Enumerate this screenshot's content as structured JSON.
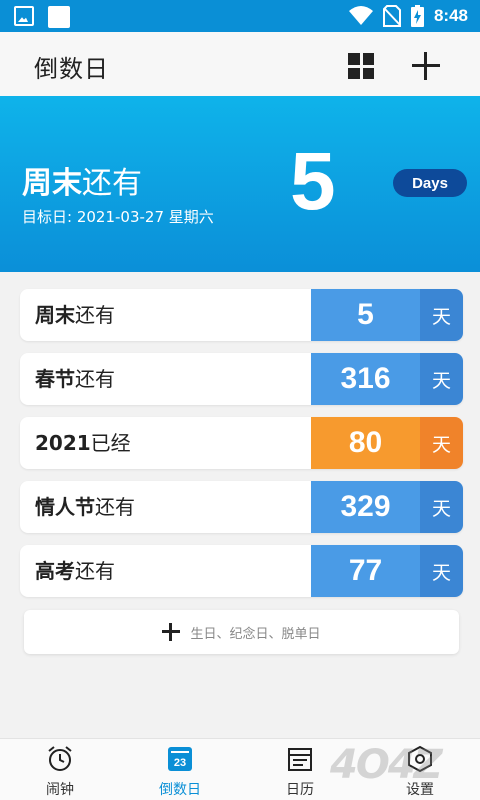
{
  "status_bar": {
    "time": "8:48"
  },
  "app_bar": {
    "title": "倒数日"
  },
  "hero": {
    "title_bold": "周末",
    "title_rest": "还有",
    "target_date": "目标日: 2021-03-27 星期六",
    "count": "5",
    "unit_badge": "Days"
  },
  "list": {
    "items": [
      {
        "name_bold": "周末",
        "name_rest": "还有",
        "count": "5",
        "unit": "天",
        "color": "#4a9be6",
        "unit_color": "#3b86d4"
      },
      {
        "name_bold": "春节",
        "name_rest": "还有",
        "count": "316",
        "unit": "天",
        "color": "#4a9be6",
        "unit_color": "#3b86d4"
      },
      {
        "name_bold": "2021",
        "name_rest": "已经",
        "count": "80",
        "unit": "天",
        "color": "#f79a2e",
        "unit_color": "#f0832a"
      },
      {
        "name_bold": "情人节",
        "name_rest": "还有",
        "count": "329",
        "unit": "天",
        "color": "#4a9be6",
        "unit_color": "#3b86d4"
      },
      {
        "name_bold": "高考",
        "name_rest": "还有",
        "count": "77",
        "unit": "天",
        "color": "#4a9be6",
        "unit_color": "#3b86d4"
      }
    ]
  },
  "add_card": {
    "hint": "生日、纪念日、脱单日"
  },
  "tabs": [
    {
      "label": "闹钟",
      "icon": "alarm-clock-icon"
    },
    {
      "label": "倒数日",
      "icon": "calendar-23-icon",
      "day": "23"
    },
    {
      "label": "日历",
      "icon": "calendar-icon"
    },
    {
      "label": "设置",
      "icon": "settings-icon"
    }
  ],
  "watermark": "4O4Z",
  "colors": {
    "primary": "#0a8fd6",
    "hero_top": "#0fb3ea",
    "badge": "#0d4a9a"
  }
}
